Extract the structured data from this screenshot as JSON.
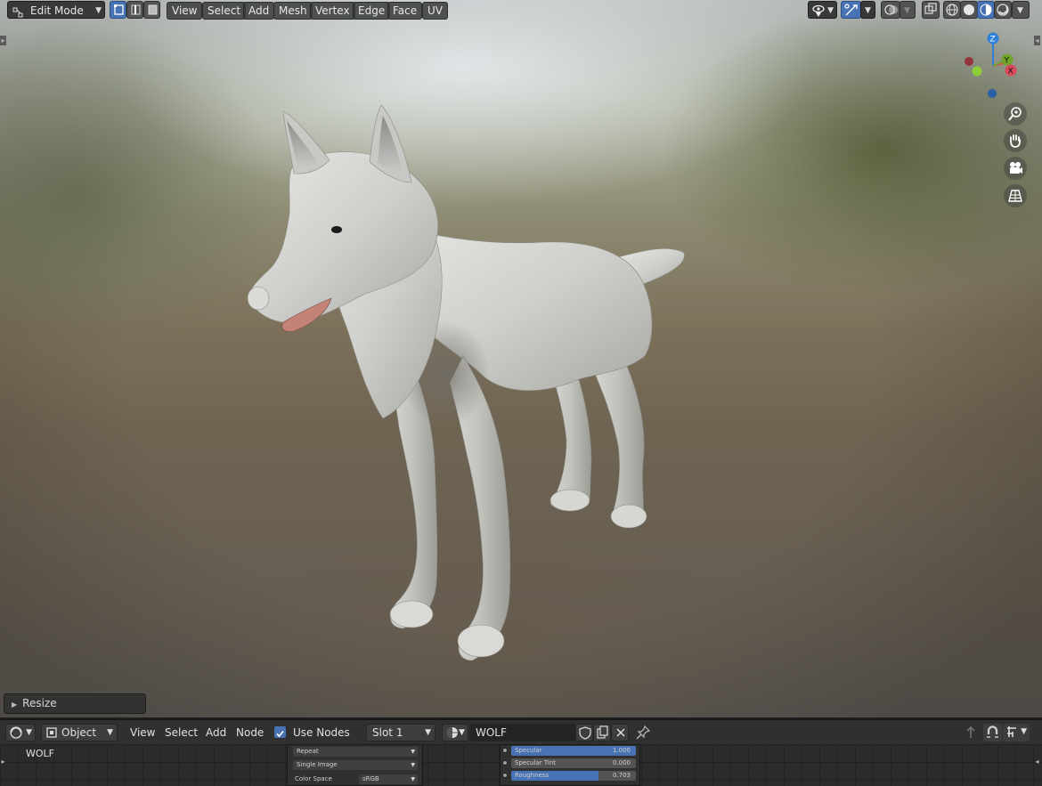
{
  "viewport_header": {
    "mode_selector": {
      "value": "Edit Mode",
      "icon": "edit-mode-icon"
    },
    "select_modes": [
      "vertex-select-icon",
      "edge-select-icon",
      "face-select-icon"
    ],
    "menus": [
      "View",
      "Select",
      "Add",
      "Mesh",
      "Vertex",
      "Edge",
      "Face",
      "UV"
    ],
    "right_tools": [
      "visibility-icon",
      "gizmo-icon",
      "overlay-icon",
      "xray-icon",
      "wireframe-shading-icon",
      "solid-shading-icon",
      "material-shading-icon",
      "rendered-shading-icon"
    ]
  },
  "gizmo": {
    "z_label": "Z",
    "y_label": "Y",
    "x_label": "X",
    "colors": {
      "z": "#2f7fd6",
      "y": "#6fa52a",
      "x": "#d94a5a"
    }
  },
  "nav_buttons": [
    "zoom-icon",
    "pan-hand-icon",
    "camera-view-icon",
    "perspective-grid-icon"
  ],
  "operator_panel": {
    "label": "Resize"
  },
  "shader_header": {
    "editor_type_icon": "shader-editor-icon",
    "object_selector": "Object",
    "menus": [
      "View",
      "Select",
      "Add",
      "Node"
    ],
    "use_nodes_label": "Use Nodes",
    "use_nodes_checked": true,
    "slot": "Slot 1",
    "material_name": "WOLF"
  },
  "node_editor": {
    "material_label": "WOLF",
    "image_node": {
      "rows": [
        "Repeat",
        "Single Image"
      ],
      "color_space_label": "Color Space",
      "color_space_value": "sRGB"
    },
    "bsdf_node": {
      "params": [
        {
          "label": "Specular",
          "value": "1.000",
          "fill": 1.0
        },
        {
          "label": "Specular Tint",
          "value": "0.000",
          "fill": 0.0
        },
        {
          "label": "Roughness",
          "value": "0.703",
          "fill": 0.703
        }
      ]
    }
  },
  "colors": {
    "accent": "#4772b3",
    "header_bg": "#303030"
  }
}
